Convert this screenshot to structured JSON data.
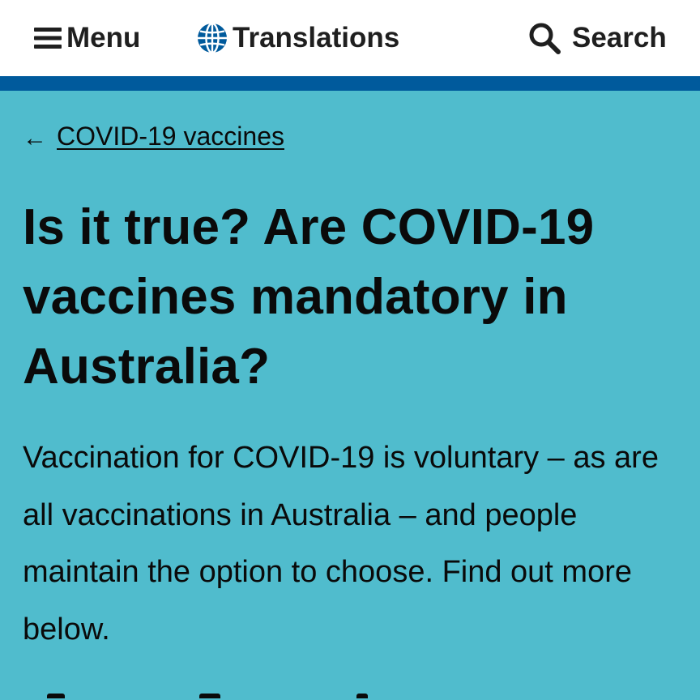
{
  "header": {
    "menu_label": "Menu",
    "menu_icon": "hamburger-icon",
    "translations_label": "Translations",
    "translations_icon": "globe-icon",
    "search_label": "Search",
    "search_icon": "magnifier-icon",
    "stripe_color": "#005a9c"
  },
  "breadcrumb": {
    "arrow": "←",
    "link_label": "COVID-19 vaccines"
  },
  "main": {
    "background_color": "#50bccd",
    "title": "Is it true? Are COVID-19 vaccines mandatory in Australia?",
    "intro": "Vaccination for COVID-19 is voluntary – as are all vaccinations in Australia – and people maintain the option to choose. Find out more below."
  }
}
